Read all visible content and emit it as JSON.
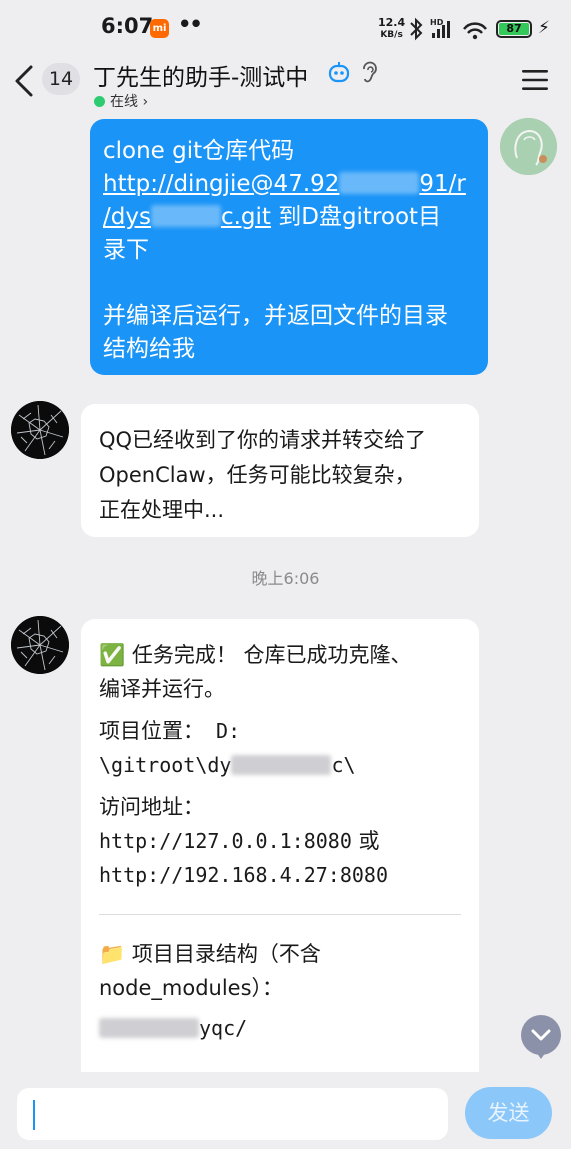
{
  "status_bar": {
    "time": "6:07",
    "carrier_badge": "mi",
    "notification_dots": "••",
    "net_speed_value": "12.4",
    "net_speed_unit": "KB/s",
    "network_label": "HD",
    "battery_percent": "87",
    "icons": [
      "bluetooth-icon",
      "signal-icon",
      "wifi-icon",
      "battery-icon",
      "charging-icon"
    ]
  },
  "header": {
    "back_label": "back",
    "unread_count": "14",
    "title": "丁先生的助手-测试中",
    "presence": "在线",
    "presence_chevron": "›",
    "presence_color": "#2ecc71"
  },
  "messages": {
    "outgoing": {
      "line1": "clone git仓库代码",
      "url_part1": "http://dingjie@47.92",
      "url_part2": "91/r",
      "url_part3": "/dys",
      "url_part4": "c.git",
      "after_url": " 到D盘gitroot目",
      "line_tail": "录下",
      "paragraph2_line1": "并编译后运行，并返回文件的目录",
      "paragraph2_line2": "结构给我",
      "bubble_color": "#1a94f7"
    },
    "incoming_1": {
      "line1": "QQ已经收到了你的请求并转交给了",
      "line2": "OpenClaw，任务可能比较复杂，",
      "line3": "正在处理中..."
    },
    "timestamp": "晚上6:06",
    "incoming_2": {
      "done_icon": "✅",
      "done_line1": " 任务完成！ 仓库已成功克隆、",
      "done_line2": "编译并运行。",
      "location_label": "项目位置：",
      "location_drive": " D:",
      "location_path_start": "\\gitroot\\dy",
      "location_path_end": "c\\",
      "access_label": "访问地址：",
      "access_url1": "http://127.0.0.1:8080",
      "access_or": " 或",
      "access_url2": "http://192.168.4.27:8080",
      "folder_icon": "📁",
      "structure_line1": " 项目目录结构（不含",
      "structure_line2": "node_modules）：",
      "root_dir_end": "yqc/"
    }
  },
  "input_bar": {
    "placeholder": "",
    "send_label": "发送",
    "send_color": "#8cc7f9"
  }
}
